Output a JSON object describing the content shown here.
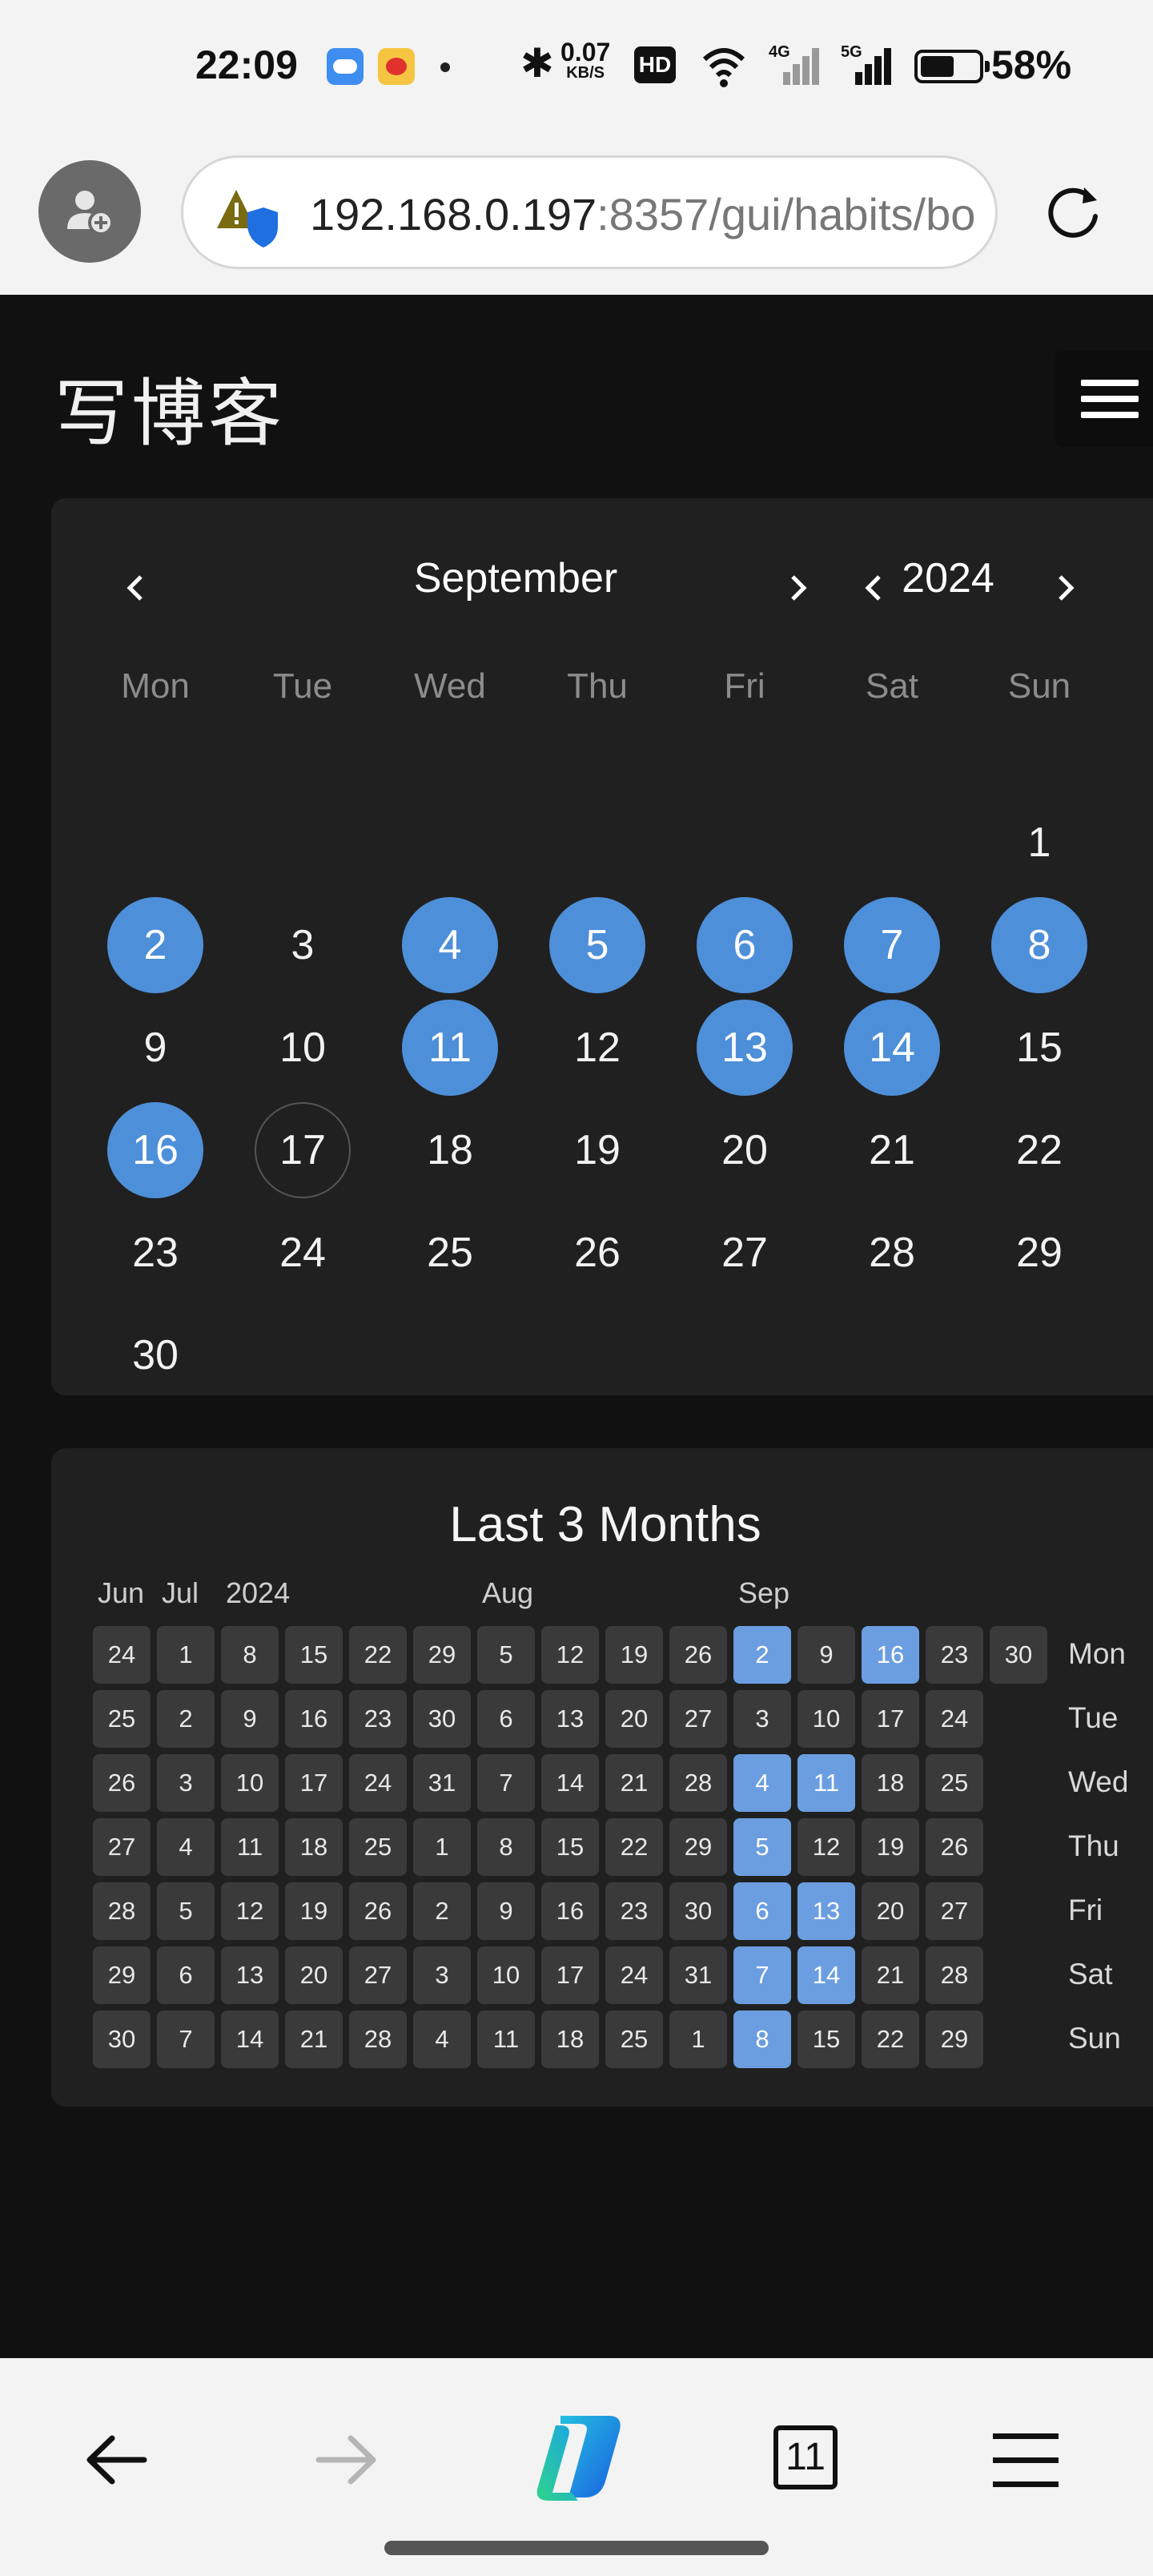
{
  "status_bar": {
    "time": "22:09",
    "network_speed": "0.07",
    "network_speed_unit": "KB/S",
    "hd_label": "HD",
    "signal_1_label": "4G",
    "signal_2_label": "5G",
    "battery_percent": "58%",
    "battery_level": 0.58
  },
  "browser": {
    "url_host": "192.168.0.197",
    "url_rest": ":8357/gui/habits/bo",
    "tab_count": "11"
  },
  "app": {
    "title": "写博客"
  },
  "calendar": {
    "month": "September",
    "year": "2024",
    "weekdays": [
      "Mon",
      "Tue",
      "Wed",
      "Thu",
      "Fri",
      "Sat",
      "Sun"
    ],
    "first_weekday_index": 6,
    "days_in_month": 30,
    "today": 17,
    "checked_days": [
      2,
      4,
      5,
      6,
      7,
      8,
      11,
      13,
      14,
      16
    ]
  },
  "heatmap": {
    "title": "Last 3 Months",
    "month_labels": [
      {
        "label": "Jun",
        "col": 0
      },
      {
        "label": "Jul",
        "col": 1
      },
      {
        "label": "2024",
        "col": 2
      },
      {
        "label": "Aug",
        "col": 6
      },
      {
        "label": "Sep",
        "col": 10
      }
    ],
    "weekday_labels": [
      "Mon",
      "Tue",
      "Wed",
      "Thu",
      "Fri",
      "Sat",
      "Sun"
    ],
    "weeks": [
      [
        24,
        25,
        26,
        27,
        28,
        29,
        30
      ],
      [
        1,
        2,
        3,
        4,
        5,
        6,
        7
      ],
      [
        8,
        9,
        10,
        11,
        12,
        13,
        14
      ],
      [
        15,
        16,
        17,
        18,
        19,
        20,
        21
      ],
      [
        22,
        23,
        24,
        25,
        26,
        27,
        28
      ],
      [
        29,
        30,
        31,
        1,
        2,
        3,
        4
      ],
      [
        5,
        6,
        7,
        8,
        9,
        10,
        11
      ],
      [
        12,
        13,
        14,
        15,
        16,
        17,
        18
      ],
      [
        19,
        20,
        21,
        22,
        23,
        24,
        25
      ],
      [
        26,
        27,
        28,
        29,
        30,
        31,
        1
      ],
      [
        2,
        3,
        4,
        5,
        6,
        7,
        8
      ],
      [
        9,
        10,
        11,
        12,
        13,
        14,
        15
      ],
      [
        16,
        17,
        18,
        19,
        20,
        21,
        22
      ],
      [
        23,
        24,
        25,
        26,
        27,
        28,
        29
      ],
      [
        30
      ]
    ],
    "checked": [
      [
        10,
        0
      ],
      [
        10,
        2
      ],
      [
        10,
        3
      ],
      [
        10,
        4
      ],
      [
        10,
        5
      ],
      [
        10,
        6
      ],
      [
        11,
        2
      ],
      [
        11,
        4
      ],
      [
        11,
        5
      ],
      [
        12,
        0
      ]
    ]
  },
  "colors": {
    "accent": "#4e8fd9",
    "heatmap_on": "#6b9ee0",
    "card_bg": "#202020",
    "page_bg": "#111111"
  },
  "icons": [
    "add-user-icon",
    "site-security-icon",
    "reload-icon",
    "menu-icon",
    "chevron-left-icon",
    "chevron-right-icon",
    "back-arrow-icon",
    "forward-arrow-icon",
    "copilot-icon",
    "tabs-icon",
    "browser-menu-icon"
  ]
}
